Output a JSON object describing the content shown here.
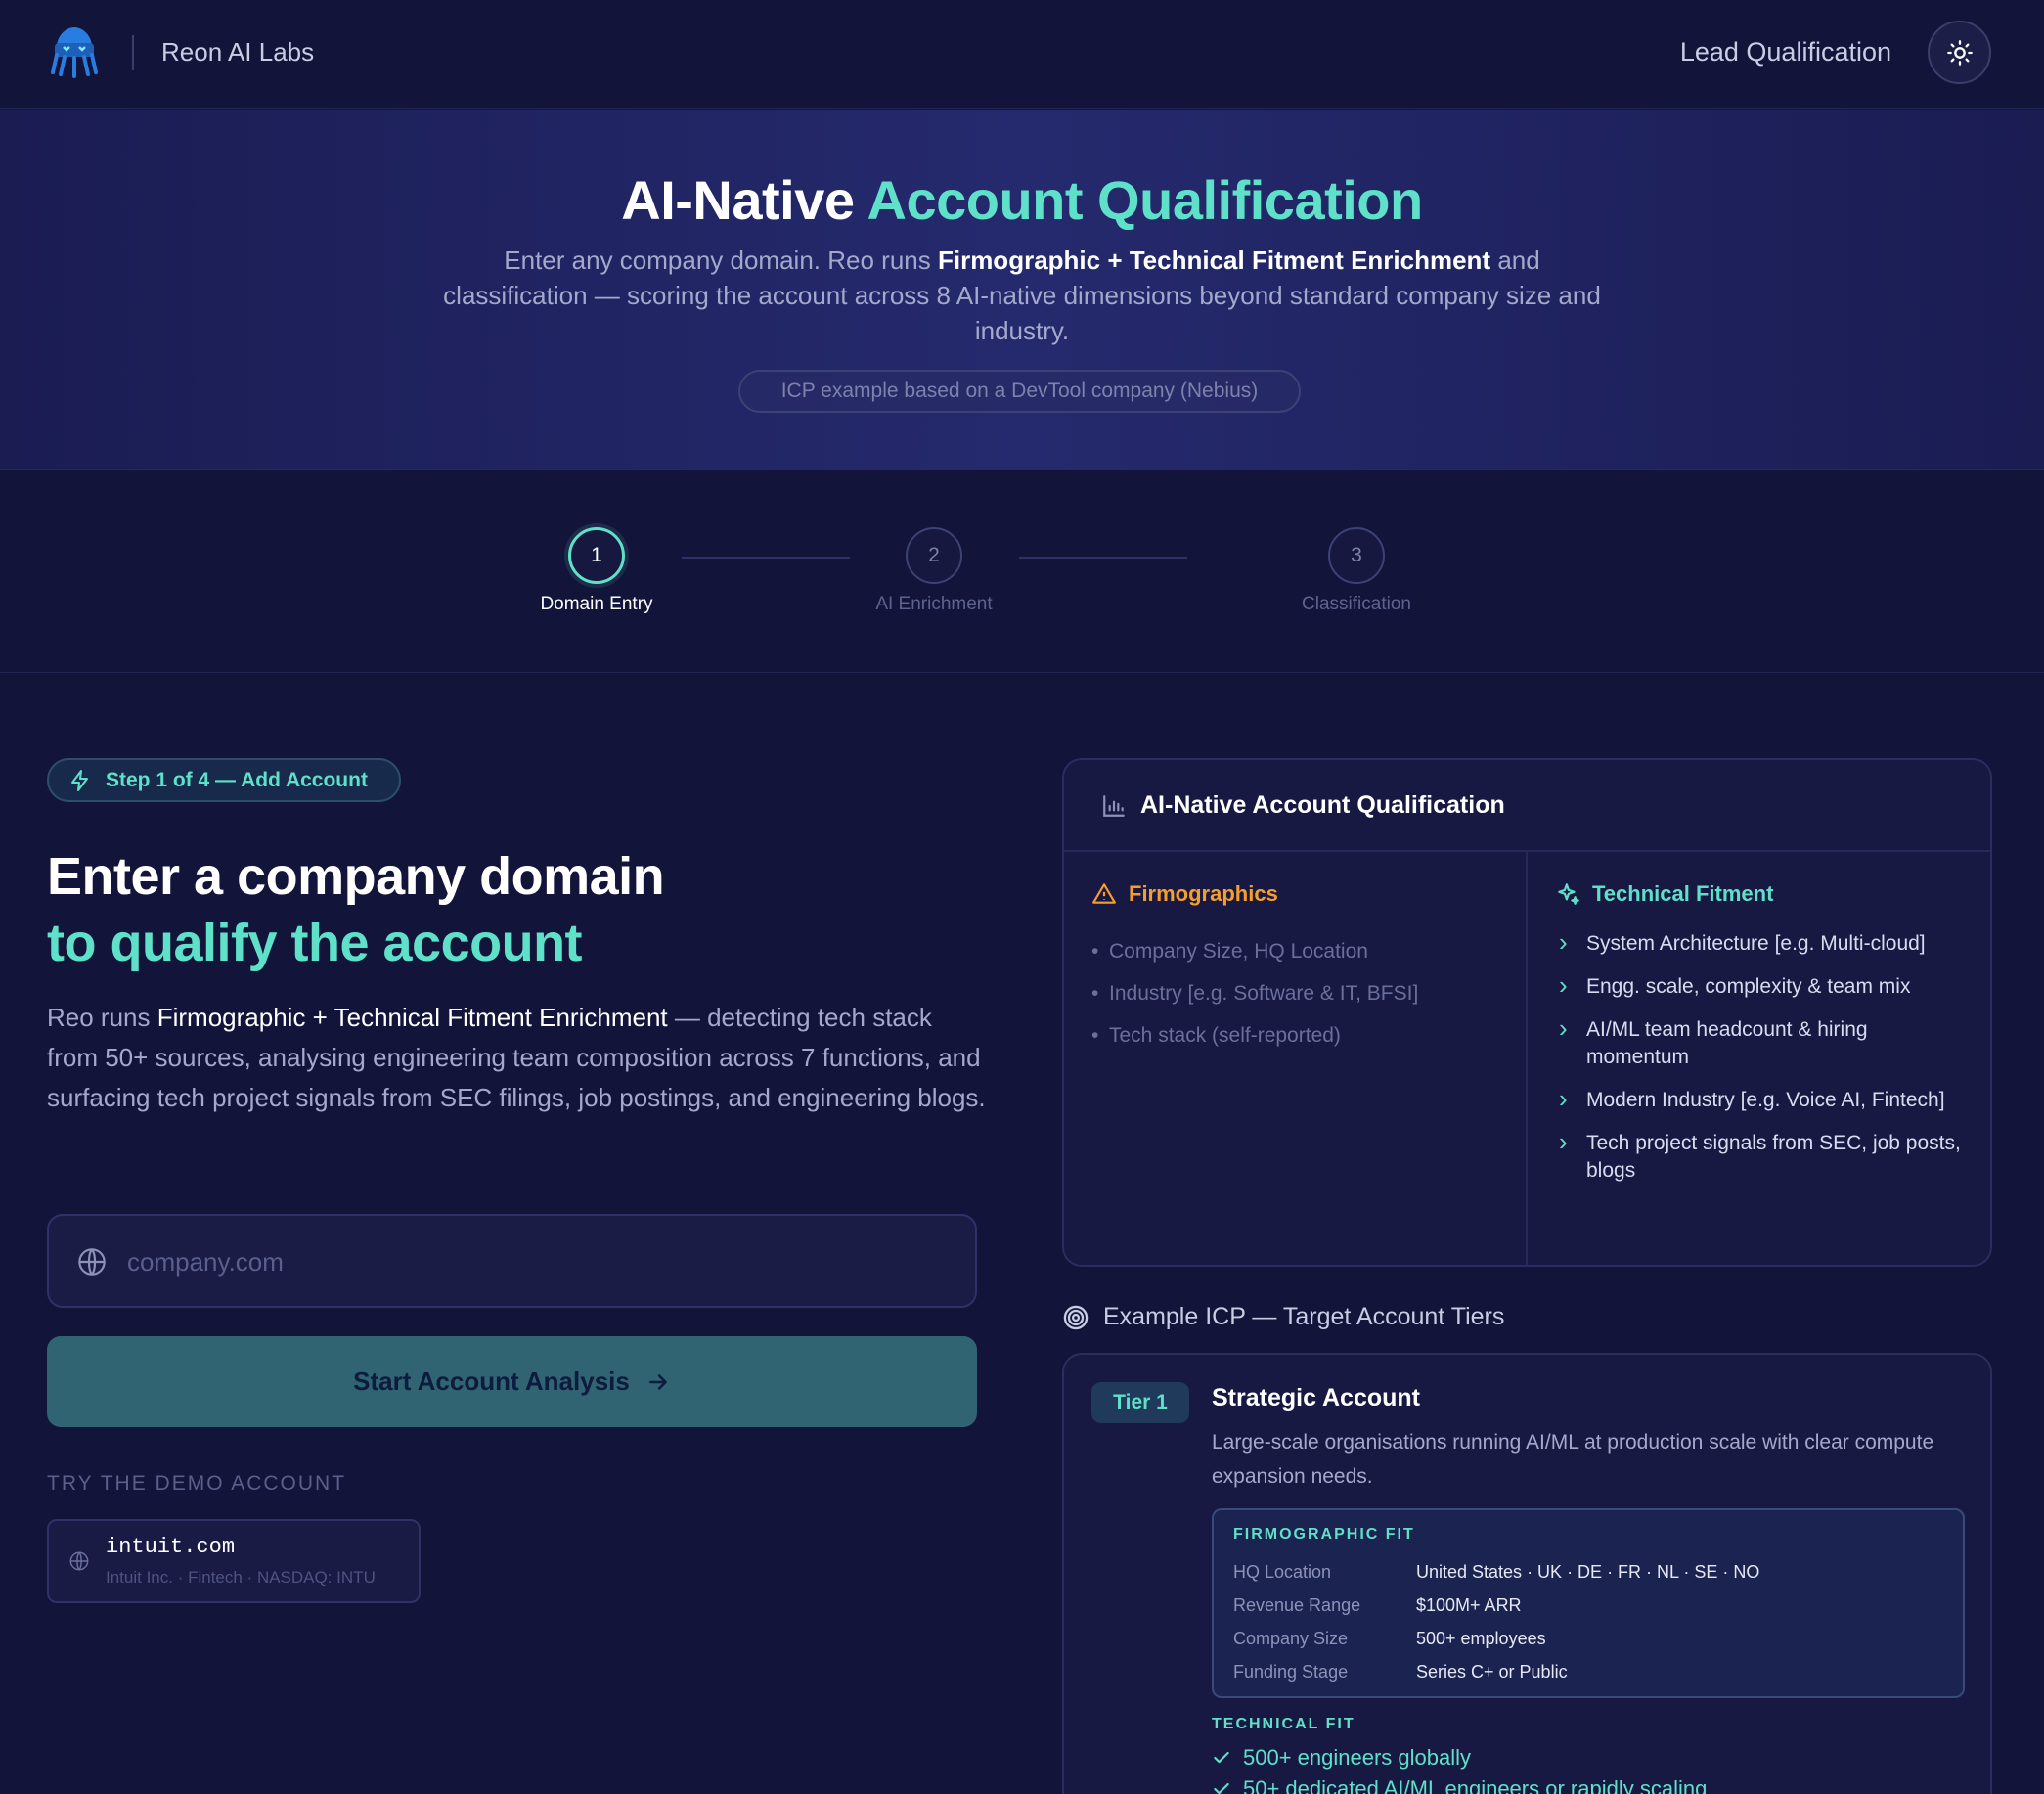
{
  "nav": {
    "brand": "Reon AI Labs",
    "right_title": "Lead Qualification",
    "theme_icon": "sun-icon",
    "logo_icon": "octopus-logo"
  },
  "hero": {
    "title_white": "AI-Native ",
    "title_accent": "Account Qualification",
    "lead_1": "Enter any company domain. Reo runs ",
    "lead_bold": "Firmographic + Technical Fitment Enrichment",
    "lead_2": " and classification — scoring the account across 8 AI-native dimensions beyond standard company size and industry.",
    "note": "ICP example based on a DevTool company (Nebius)"
  },
  "stepper": {
    "steps": [
      {
        "num": "1",
        "label": "Domain Entry"
      },
      {
        "num": "2",
        "label": "AI Enrichment"
      },
      {
        "num": "3",
        "label": "Classification"
      }
    ]
  },
  "left": {
    "badge": "Step 1 of 4 — Add Account",
    "heading_line1": "Enter a company domain",
    "heading_line2": "to qualify the account",
    "body_1": "Reo runs ",
    "body_bold": "Firmographic + Technical Fitment Enrichment",
    "body_2": " — detecting tech stack from 50+ sources, analysing engineering team composition across 7 functions, and surfacing tech project signals from SEC filings, job postings, and engineering blogs.",
    "input_placeholder": "company.com",
    "start_button": "Start Account Analysis",
    "demo_label": "TRY THE DEMO ACCOUNT",
    "demo_domain": "intuit.com",
    "demo_sub": "Intuit Inc. · Fintech · NASDAQ: INTU"
  },
  "qualification": {
    "title": "AI-Native Account Qualification",
    "firmo_title": "Firmographics",
    "firmo_items": [
      "Company Size, HQ Location",
      "Industry [e.g. Software & IT, BFSI]",
      "Tech stack (self-reported)"
    ],
    "tech_title": "Technical Fitment",
    "tech_items": [
      "System Architecture [e.g. Multi-cloud]",
      "Engg. scale, complexity & team mix",
      "AI/ML team headcount & hiring momentum",
      "Modern Industry [e.g. Voice AI, Fintech]",
      "Tech project signals from SEC, job posts, blogs"
    ],
    "colors": {
      "firmo": "#f59e2b",
      "tech": "#5fe0c9"
    }
  },
  "icp": {
    "title": "Example ICP — Target Account Tiers",
    "tier": {
      "pill": "Tier 1",
      "name": "Strategic Account",
      "desc": "Large-scale organisations running AI/ML at production scale with clear compute expansion needs.",
      "firmo_title": "FIRMOGRAPHIC FIT",
      "firmo_rows": [
        {
          "label": "HQ Location",
          "value": "United States · UK · DE · FR · NL · SE · NO"
        },
        {
          "label": "Revenue Range",
          "value": "$100M+ ARR"
        },
        {
          "label": "Company Size",
          "value": "500+ employees"
        },
        {
          "label": "Funding Stage",
          "value": "Series C+ or Public"
        }
      ],
      "tech_title": "TECHNICAL FIT",
      "tech_checks": [
        "500+ engineers globally",
        "50+ dedicated AI/ML engineers or rapidly scaling"
      ]
    }
  }
}
